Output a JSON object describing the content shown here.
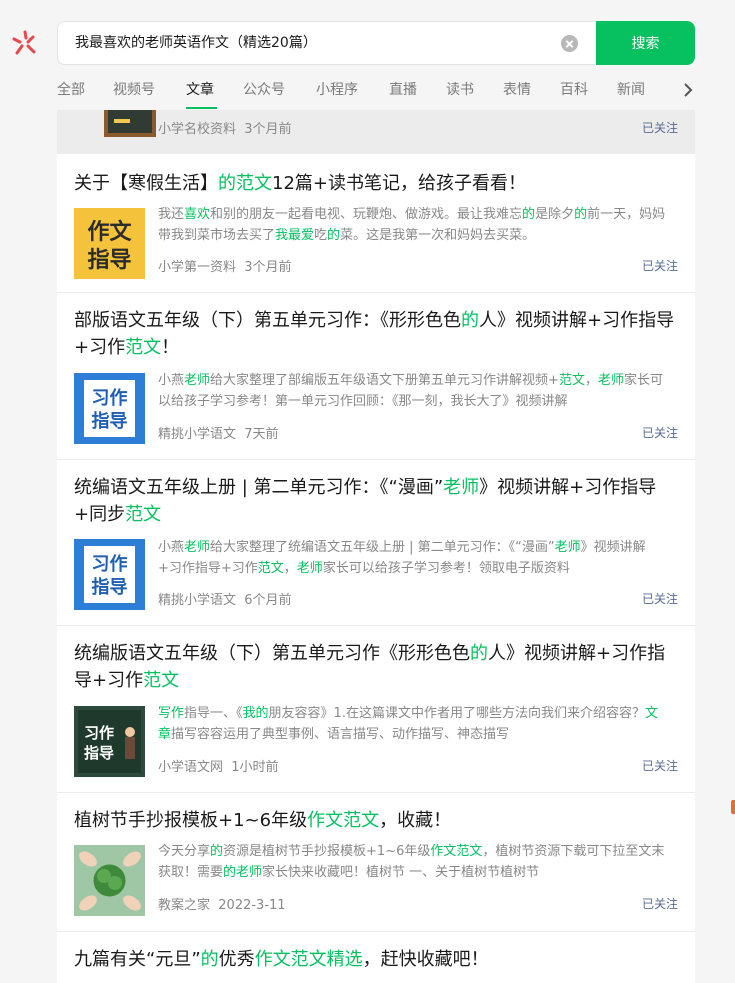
{
  "search": {
    "query": "我最喜欢的老师英语作文（精选20篇）",
    "button_label": "搜索"
  },
  "tabs": [
    {
      "label": "全部",
      "active": false
    },
    {
      "label": "视频号",
      "active": false
    },
    {
      "label": "文章",
      "active": true
    },
    {
      "label": "公众号",
      "active": false
    },
    {
      "label": "小程序",
      "active": false
    },
    {
      "label": "直播",
      "active": false
    },
    {
      "label": "读书",
      "active": false
    },
    {
      "label": "表情",
      "active": false
    },
    {
      "label": "百科",
      "active": false
    },
    {
      "label": "新闻",
      "active": false
    }
  ],
  "colors": {
    "accent": "#07c160",
    "link": "#576b95"
  },
  "results": [
    {
      "title_parts": [],
      "snippet_parts": [],
      "source": "小学名校资料",
      "time": "3个月前",
      "followed": "已关注",
      "thumb_icon": "chalkboard-thumbnail"
    },
    {
      "title_parts": [
        [
          "关于【寒假生活】",
          0
        ],
        [
          "的范文",
          1
        ],
        [
          "12篇+读书笔记，给孩子看看！",
          0
        ]
      ],
      "snippet_parts": [
        [
          "我还",
          0
        ],
        [
          "喜欢",
          1
        ],
        [
          "和别的朋友一起看电视、玩鞭炮、做游戏。最让我难忘",
          0
        ],
        [
          "的",
          1
        ],
        [
          "是除夕",
          0
        ],
        [
          "的",
          1
        ],
        [
          "前一天，妈妈带我到菜市场去买了",
          0
        ],
        [
          "我最爱",
          1
        ],
        [
          "吃",
          0
        ],
        [
          "的",
          1
        ],
        [
          "菜。这是我第一次和妈妈去买菜。",
          0
        ]
      ],
      "source": "小学第一资料",
      "time": "3个月前",
      "followed": "已关注",
      "thumb_icon": "zuowen-zhidao-thumbnail",
      "thumb_text": [
        "作文",
        "指导"
      ]
    },
    {
      "title_parts": [
        [
          "部版语文五年级（下）第五单元习作：《形形色色",
          0
        ],
        [
          "的",
          1
        ],
        [
          "人》视频讲解+习作指导+习作",
          0
        ],
        [
          "范文",
          1
        ],
        [
          "！",
          0
        ]
      ],
      "snippet_parts": [
        [
          "小燕",
          0
        ],
        [
          "老师",
          1
        ],
        [
          "给大家整理了部编版五年级语文下册第五单元习作讲解视频+",
          0
        ],
        [
          "范文",
          1
        ],
        [
          "，",
          0
        ],
        [
          "老师",
          1
        ],
        [
          "家长可以给孩子学习参考！第一单元习作回顾：《那一刻，我长大了》视频讲解",
          0
        ]
      ],
      "source": "精挑小学语文",
      "time": "7天前",
      "followed": "已关注",
      "thumb_icon": "xizuo-zhidao-thumbnail",
      "thumb_text": [
        "习作",
        "指导"
      ]
    },
    {
      "title_parts": [
        [
          "统编语文五年级上册 | 第二单元习作：《“漫画”",
          0
        ],
        [
          "老师",
          1
        ],
        [
          "》视频讲解+习作指导+同步",
          0
        ],
        [
          "范文",
          1
        ]
      ],
      "snippet_parts": [
        [
          "小燕",
          0
        ],
        [
          "老师",
          1
        ],
        [
          "给大家整理了统编语文五年级上册 | 第二单元习作：《“漫画”",
          0
        ],
        [
          "老师",
          1
        ],
        [
          "》视频讲解+习作指导+习作",
          0
        ],
        [
          "范文",
          1
        ],
        [
          "，",
          0
        ],
        [
          "老师",
          1
        ],
        [
          "家长可以给孩子学习参考！领取电子版资料",
          0
        ]
      ],
      "source": "精挑小学语文",
      "time": "6个月前",
      "followed": "已关注",
      "thumb_icon": "xizuo-zhidao-thumbnail",
      "thumb_text": [
        "习作",
        "指导"
      ]
    },
    {
      "title_parts": [
        [
          "统编版语文五年级（下）第五单元习作《形形色色",
          0
        ],
        [
          "的",
          1
        ],
        [
          "人》视频讲解+习作指导+习作",
          0
        ],
        [
          "范文",
          1
        ]
      ],
      "snippet_parts": [
        [
          "写作",
          1
        ],
        [
          "指导一、《",
          0
        ],
        [
          "我的",
          1
        ],
        [
          "朋友容容》1.在这篇课文中作者用了哪些方法向我们来介绍容容？",
          0
        ],
        [
          "文章",
          1
        ],
        [
          "描写容容运用了典型事例、语言描写、动作描写、神态描写",
          0
        ]
      ],
      "source": "小学语文网",
      "time": "1小时前",
      "followed": "已关注",
      "thumb_icon": "blackboard-xizuo-thumbnail",
      "thumb_text": [
        "习作",
        "指导"
      ]
    },
    {
      "title_parts": [
        [
          "植树节手抄报模板+1~6年级",
          0
        ],
        [
          "作文范文",
          1
        ],
        [
          "，收藏！",
          0
        ]
      ],
      "snippet_parts": [
        [
          "今天分享",
          0
        ],
        [
          "的",
          1
        ],
        [
          "资源是植树节手抄报模板+1~6年级",
          0
        ],
        [
          "作文范文",
          1
        ],
        [
          "，植树节资源下载可下拉至文末获取！需要",
          0
        ],
        [
          "的老师",
          1
        ],
        [
          "家长快来收藏吧！植树节 一、关于植树节植树节",
          0
        ]
      ],
      "source": "教案之家",
      "time": "2022-3-11",
      "followed": "已关注",
      "thumb_icon": "plant-hands-thumbnail"
    },
    {
      "title_parts": [
        [
          "九篇有关“元旦”",
          0
        ],
        [
          "的",
          1
        ],
        [
          "优秀",
          0
        ],
        [
          "作文范文精选",
          1
        ],
        [
          "，赶快收藏吧！",
          0
        ]
      ],
      "snippet_parts": [],
      "source": "",
      "time": "",
      "followed": "",
      "thumb_icon": ""
    }
  ]
}
